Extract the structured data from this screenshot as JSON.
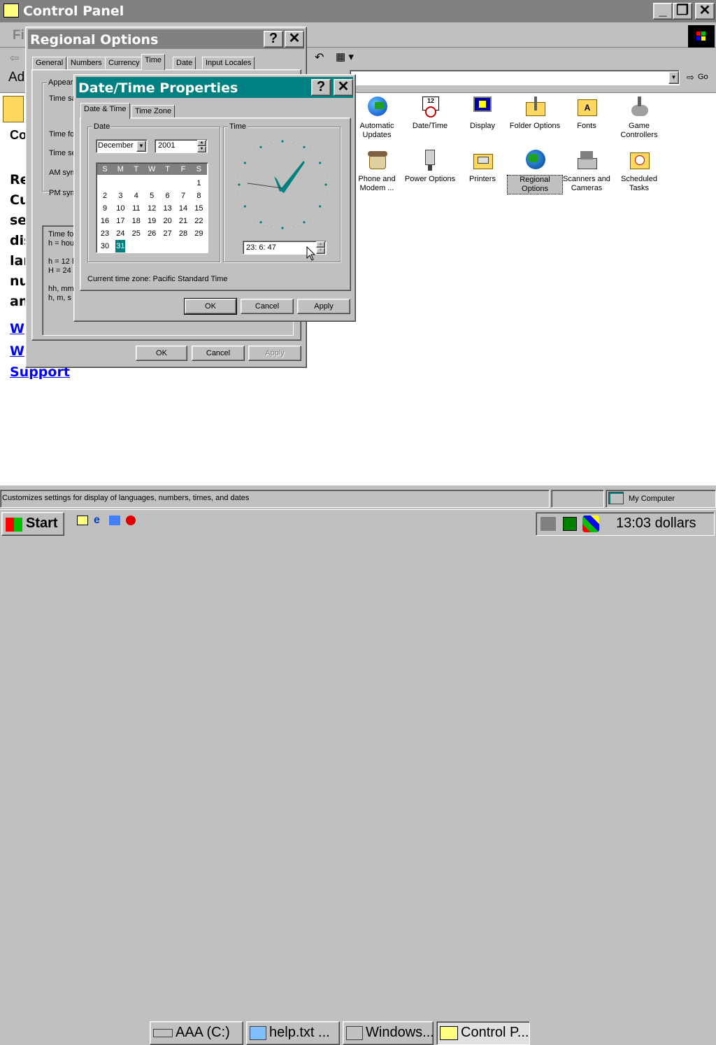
{
  "control_panel": {
    "title": "Control Panel",
    "menu_first_letter": "Fi",
    "address_label": "Ad",
    "go_label": "Go",
    "left_heading": "Co",
    "left_text_lines": [
      "Re",
      "Cu",
      "se",
      "dis",
      "lar",
      "nu",
      "an"
    ],
    "links": [
      "W",
      "W",
      "Support"
    ],
    "icons": [
      {
        "label": "Automatic Updates"
      },
      {
        "label": "Date/Time"
      },
      {
        "label": "Display"
      },
      {
        "label": "Folder Options"
      },
      {
        "label": "Fonts"
      },
      {
        "label": "Game Controllers"
      },
      {
        "label": "Phone and Modem ..."
      },
      {
        "label": "Power Options"
      },
      {
        "label": "Printers"
      },
      {
        "label": "Regional Options"
      },
      {
        "label": "Scanners and Cameras"
      },
      {
        "label": "Scheduled Tasks"
      }
    ],
    "status_text": "Customizes settings for display of languages, numbers, times, and dates",
    "status_zone": "My Computer"
  },
  "regional": {
    "title": "Regional Options",
    "tabs": [
      "General",
      "Numbers",
      "Currency",
      "Time",
      "Date",
      "Input Locales"
    ],
    "active_tab": "Time",
    "appearance_label": "Appeara",
    "time_sample_label": "Time sa",
    "time_format_label": "Time for",
    "time_sep_label": "Time se",
    "am_label": "AM sym",
    "pm_label": "PM sym",
    "notes": [
      "Time for",
      "h = hou",
      "",
      "h = 12 h",
      "H = 24 h",
      "",
      "hh, mm,",
      "h, m, s ="
    ],
    "ok": "OK",
    "cancel": "Cancel",
    "apply": "Apply"
  },
  "datetime": {
    "title": "Date/Time Properties",
    "tabs": [
      "Date & Time",
      "Time Zone"
    ],
    "date_group": "Date",
    "time_group": "Time",
    "month": "December",
    "year": "2001",
    "weekdays": [
      "S",
      "M",
      "T",
      "W",
      "T",
      "F",
      "S"
    ],
    "days": [
      "1",
      "2",
      "3",
      "4",
      "5",
      "6",
      "7",
      "8",
      "9",
      "10",
      "11",
      "12",
      "13",
      "14",
      "15",
      "16",
      "17",
      "18",
      "19",
      "20",
      "21",
      "22",
      "23",
      "24",
      "25",
      "26",
      "27",
      "28",
      "29",
      "30",
      "31"
    ],
    "first_weekday": 6,
    "selected_day": "31",
    "time_value": "23:  6: 47",
    "time_zone_text": "Current time zone:  Pacific Standard Time",
    "ok": "OK",
    "cancel": "Cancel",
    "apply": "Apply"
  },
  "taskbar": {
    "start": "Start",
    "tasks": [
      "AAA (C:)",
      "help.txt ...",
      "Windows...",
      "Control P..."
    ],
    "clock": "13:03 dollars"
  },
  "colors": {
    "titlebar_active": "#008080",
    "titlebar_inactive": "#808080",
    "accent": "#008080",
    "link": "#0000ff"
  }
}
